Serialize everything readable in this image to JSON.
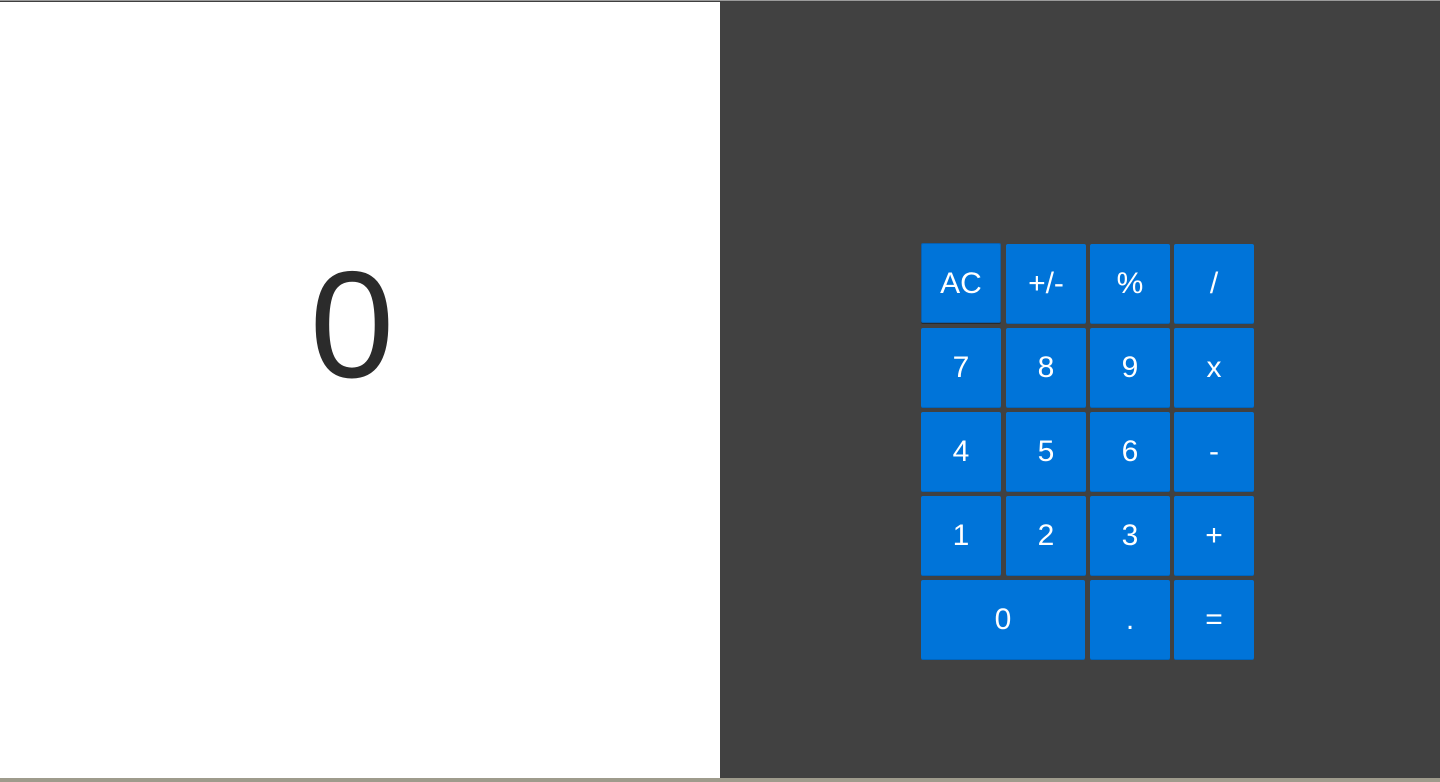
{
  "display": {
    "value": "0"
  },
  "keys": {
    "ac": "AC",
    "sign": "+/-",
    "percent": "%",
    "divide": "/",
    "seven": "7",
    "eight": "8",
    "nine": "9",
    "multiply": "x",
    "four": "4",
    "five": "5",
    "six": "6",
    "subtract": "-",
    "one": "1",
    "two": "2",
    "three": "3",
    "add": "+",
    "zero": "0",
    "decimal": ".",
    "equals": "="
  },
  "colors": {
    "display_background": "#ffffff",
    "display_text": "#2b2b2b",
    "keypad_background": "#414141",
    "key_background": "#0074d9",
    "key_text": "#ffffff"
  }
}
